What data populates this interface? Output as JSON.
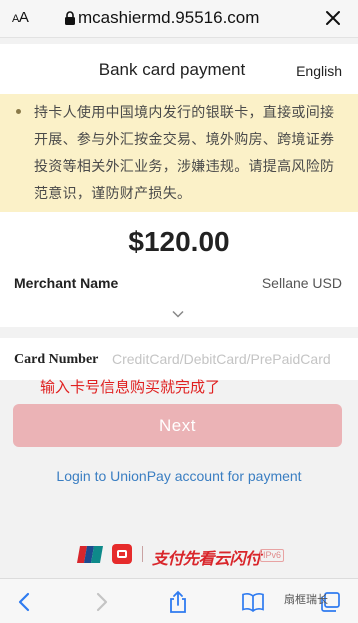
{
  "browser": {
    "text_size_label": "AA",
    "url": "mcashiermd.95516.com"
  },
  "header": {
    "title": "Bank card payment",
    "language": "English"
  },
  "notice": {
    "text": "持卡人使用中国境内发行的银联卡，直接或间接开展、参与外汇按金交易、境外购房、跨境证券投资等相关外汇业务，涉嫌违规。请提高风险防范意识，谨防财产损失。"
  },
  "order": {
    "amount": "$120.00",
    "merchant_label": "Merchant Name",
    "merchant_value": "Sellane USD"
  },
  "card": {
    "label": "Card Number",
    "placeholder": "CreditCard/DebitCard/PrePaidCard",
    "value": ""
  },
  "annotation": "输入卡号信息购买就完成了",
  "actions": {
    "next_label": "Next",
    "login_link": "Login to UnionPay account for payment"
  },
  "footer": {
    "slogan": "支付先看云闪付",
    "ipv6_badge": "IPv6"
  },
  "watermark": "扇框瑞长",
  "colors": {
    "notice_bg": "#fbf1c8",
    "next_button": "#ebb3b6",
    "link": "#3a7ec2",
    "annotation": "#e02020",
    "brand_red": "#d9262b"
  },
  "icons": [
    "lock-icon",
    "close-icon",
    "chevron-down-icon",
    "unionpay-logo",
    "quickpass-logo",
    "back-icon",
    "forward-icon",
    "share-icon",
    "bookmarks-icon",
    "tabs-icon"
  ]
}
